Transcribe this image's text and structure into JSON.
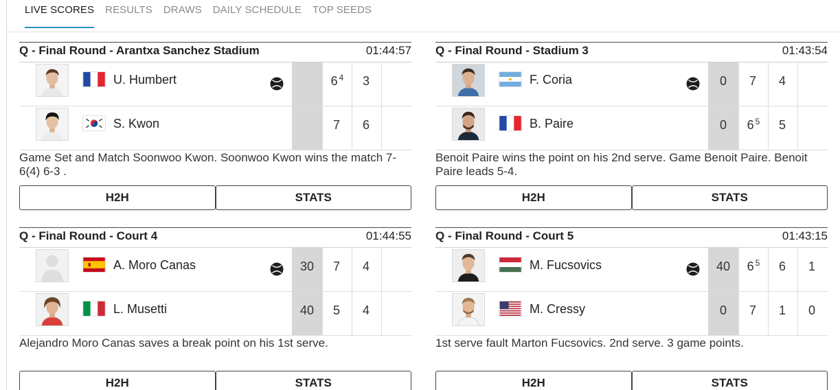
{
  "tabs": [
    {
      "label": "LIVE SCORES",
      "active": true
    },
    {
      "label": "RESULTS",
      "active": false
    },
    {
      "label": "DRAWS",
      "active": false
    },
    {
      "label": "DAILY SCHEDULE",
      "active": false
    },
    {
      "label": "TOP SEEDS",
      "active": false
    }
  ],
  "accent_color": "#2a8fc7",
  "point_cell_color": "#d7d7d7",
  "matches": [
    {
      "title": "Q - Final Round - Arantxa Sanchez Stadium",
      "time": "01:44:57",
      "players": [
        {
          "name": "U. Humbert",
          "flag": "france-flag",
          "serving": true,
          "points": "",
          "sets": [
            {
              "g": "6",
              "tb": "4"
            },
            {
              "g": "3",
              "tb": ""
            }
          ]
        },
        {
          "name": "S. Kwon",
          "flag": "south-korea-flag",
          "serving": false,
          "points": "",
          "sets": [
            {
              "g": "7",
              "tb": ""
            },
            {
              "g": "6",
              "tb": ""
            }
          ]
        }
      ],
      "commentary": "Game Set and Match Soonwoo Kwon. Soonwoo Kwon wins the match 7-6(4) 6-3 .",
      "h2h_label": "H2H",
      "stats_label": "STATS"
    },
    {
      "title": "Q - Final Round - Stadium 3",
      "time": "01:43:54",
      "players": [
        {
          "name": "F. Coria",
          "flag": "argentina-flag",
          "serving": true,
          "points": "0",
          "sets": [
            {
              "g": "7",
              "tb": ""
            },
            {
              "g": "4",
              "tb": ""
            }
          ]
        },
        {
          "name": "B. Paire",
          "flag": "france-flag",
          "serving": false,
          "points": "0",
          "sets": [
            {
              "g": "6",
              "tb": "5"
            },
            {
              "g": "5",
              "tb": ""
            }
          ]
        }
      ],
      "commentary": "Benoit Paire wins the point on his 2nd serve. Game Benoit Paire. Benoit Paire leads 5-4.",
      "h2h_label": "H2H",
      "stats_label": "STATS"
    },
    {
      "title": "Q - Final Round - Court 4",
      "time": "01:44:55",
      "players": [
        {
          "name": "A. Moro Canas",
          "flag": "spain-flag",
          "serving": true,
          "points": "30",
          "sets": [
            {
              "g": "7",
              "tb": ""
            },
            {
              "g": "4",
              "tb": ""
            }
          ]
        },
        {
          "name": "L. Musetti",
          "flag": "italy-flag",
          "serving": false,
          "points": "40",
          "sets": [
            {
              "g": "5",
              "tb": ""
            },
            {
              "g": "4",
              "tb": ""
            }
          ]
        }
      ],
      "commentary": "Alejandro Moro Canas saves a break point on his 1st serve.",
      "h2h_label": "H2H",
      "stats_label": "STATS"
    },
    {
      "title": "Q - Final Round - Court 5",
      "time": "01:43:15",
      "players": [
        {
          "name": "M. Fucsovics",
          "flag": "hungary-flag",
          "serving": true,
          "points": "40",
          "sets": [
            {
              "g": "6",
              "tb": "5"
            },
            {
              "g": "6",
              "tb": ""
            },
            {
              "g": "1",
              "tb": ""
            }
          ]
        },
        {
          "name": "M. Cressy",
          "flag": "usa-flag",
          "serving": false,
          "points": "0",
          "sets": [
            {
              "g": "7",
              "tb": ""
            },
            {
              "g": "1",
              "tb": ""
            },
            {
              "g": "0",
              "tb": ""
            }
          ]
        }
      ],
      "commentary": "1st serve fault Marton Fucsovics. 2nd serve. 3 game points.",
      "h2h_label": "H2H",
      "stats_label": "STATS"
    }
  ]
}
